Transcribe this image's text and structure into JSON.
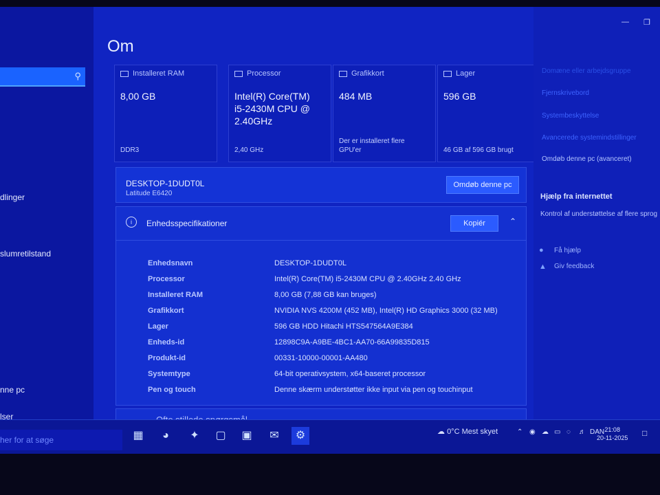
{
  "page": {
    "title": "Om"
  },
  "left_nav": {
    "search_icon": "search-icon",
    "items": [
      "dlinger",
      "slumretilstand",
      "nne pc",
      "lser"
    ]
  },
  "cards": [
    {
      "header": "Installeret RAM",
      "value": "8,00 GB",
      "foot": "DDR3"
    },
    {
      "header": "Processor",
      "value": "Intel(R) Core(TM) i5-2430M CPU @ 2.40GHz",
      "foot": "2,40 GHz"
    },
    {
      "header": "Grafikkort",
      "value": "484 MB",
      "foot": "Der er installeret flere GPU'er"
    },
    {
      "header": "Lager",
      "value": "596 GB",
      "foot": "46 GB af 596 GB brugt"
    }
  ],
  "device": {
    "name": "DESKTOP-1DUDT0L",
    "model": "Latitude E6420",
    "rename_label": "Omdøb denne pc"
  },
  "specs": {
    "title": "Enhedsspecifikationer",
    "copy_label": "Kopiér",
    "rows": [
      {
        "k": "Enhedsnavn",
        "v": "DESKTOP-1DUDT0L"
      },
      {
        "k": "Processor",
        "v": "Intel(R) Core(TM) i5-2430M CPU @ 2.40GHz   2.40 GHz"
      },
      {
        "k": "Installeret RAM",
        "v": "8,00 GB (7,88 GB kan bruges)"
      },
      {
        "k": "Grafikkort",
        "v": "NVIDIA NVS 4200M (452 MB), Intel(R) HD Graphics 3000 (32 MB)"
      },
      {
        "k": "Lager",
        "v": "596 GB HDD Hitachi HTS547564A9E384"
      },
      {
        "k": "Enheds-id",
        "v": "12898C9A-A9BE-4BC1-AA70-66A99835D815"
      },
      {
        "k": "Produkt-id",
        "v": "00331-10000-00001-AA480"
      },
      {
        "k": "Systemtype",
        "v": "64-bit operativsystem, x64-baseret processor"
      },
      {
        "k": "Pen og touch",
        "v": "Denne skærm understøtter ikke input via pen og touchinput"
      }
    ]
  },
  "faq_label": "Ofte stillede spørgsmål",
  "right_pane": {
    "related": [
      "Domæne eller arbejdsgruppe",
      "Fjernskrivebord",
      "Systembeskyttelse",
      "Avancerede systemindstillinger",
      "Omdøb denne pc (avanceret)"
    ],
    "help_title": "Hjælp fra internettet",
    "help_text": "Kontrol af understøttelse af flere sprog",
    "get_help": "Få hjælp",
    "feedback": "Giv feedback"
  },
  "taskbar": {
    "search_placeholder": "her for at søge",
    "weather": "0°C  Mest skyet",
    "lang": "DAN",
    "time": "21:08",
    "date": "20-11-2025"
  }
}
